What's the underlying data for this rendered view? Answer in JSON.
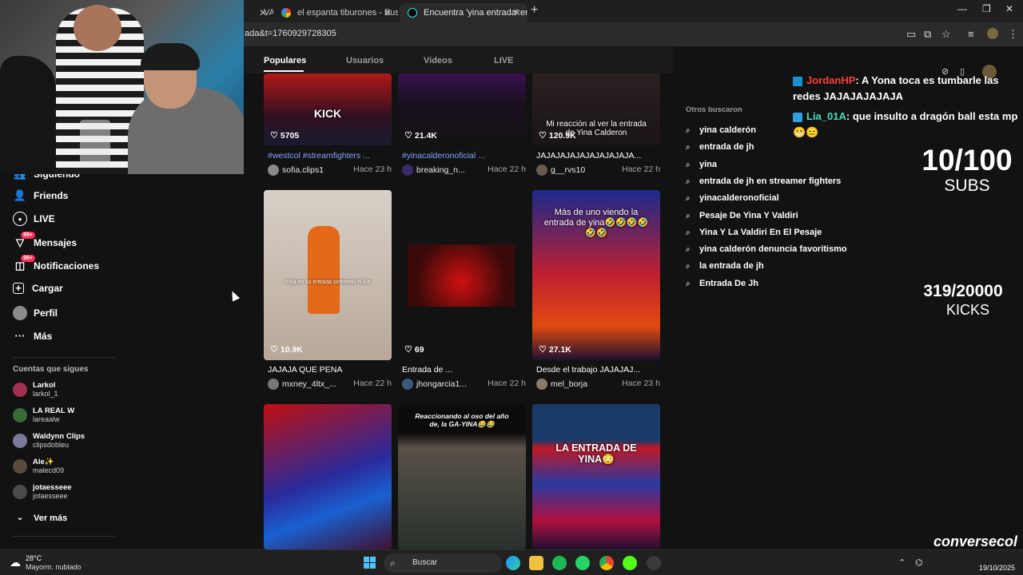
{
  "browser": {
    "tabs": [
      {
        "label": "VA",
        "active": false
      },
      {
        "label": "el espanta tiburones - Buscar c",
        "active": false
      },
      {
        "label": "Encuentra 'yina entrada' en Tik",
        "active": true
      }
    ],
    "url": "ada&t=1760929728305",
    "new_tab": "+",
    "controls": {
      "minimize": "—",
      "restore": "❐",
      "close": "✕"
    }
  },
  "search_tabs": [
    "Populares",
    "Usuarios",
    "Videos",
    "LIVE"
  ],
  "sidebar": {
    "items": [
      {
        "label": "Siguiendo",
        "icon": "following-icon"
      },
      {
        "label": "Friends",
        "icon": "friends-icon"
      },
      {
        "label": "LIVE",
        "icon": "live-icon"
      },
      {
        "label": "Mensajes",
        "icon": "messages-icon",
        "badge": "99+"
      },
      {
        "label": "Notificaciones",
        "icon": "notifications-icon",
        "badge": "99+"
      },
      {
        "label": "Cargar",
        "icon": "upload-icon"
      },
      {
        "label": "Perfil",
        "icon": "profile-icon"
      },
      {
        "label": "Más",
        "icon": "more-icon"
      }
    ],
    "following_title": "Cuentas que sigues",
    "following": [
      {
        "name": "Larkol",
        "handle": "larkol_1"
      },
      {
        "name": "LA REAL W",
        "handle": "lareaalw"
      },
      {
        "name": "Waldynn Clips",
        "handle": "clipsdobleu"
      },
      {
        "name": "Ale✨",
        "handle": "malecd09"
      },
      {
        "name": "jotaesseee",
        "handle": "jotaesseee"
      }
    ],
    "see_more": "Ver más"
  },
  "videos": [
    {
      "likes": "5705",
      "caption": "#westcol #streamfighters ...",
      "user": "sofia.clips1",
      "time": "Hace 23 h",
      "overlay": "KICK",
      "tag": true
    },
    {
      "likes": "21.4K",
      "caption": "#yinacalderonoficial ...",
      "user": "breaking_n...",
      "time": "Hace 22 h",
      "overlay": "",
      "tag": true
    },
    {
      "likes": "120.9K",
      "caption": "JAJAJAJAJAJAJAJAJAJA...",
      "user": "g__rvs10",
      "time": "Hace 22 h",
      "overlay": "Mi reacción al ver la entrada de Yina Calderon",
      "tag": false
    },
    {
      "likes": "10.9K",
      "caption": "JAJAJA QUE PENA",
      "user": "mxney_4ltx_...",
      "time": "Hace 22 h",
      "overlay": "Yina en su entrada sintiendo el kie",
      "tag": false
    },
    {
      "likes": "69",
      "caption": "Entrada de ...",
      "user": "jhongarcia1...",
      "time": "Hace 22 h",
      "overlay": "",
      "tag": false
    },
    {
      "likes": "27.1K",
      "caption": "Desde el trabajo JAJAJAJ...",
      "user": "mel_borja",
      "time": "Hace 23 h",
      "overlay": "Más de uno viendo la entrada de yina🤣🤣🤣🤣🤣🤣",
      "tag": false
    },
    {
      "likes": "",
      "caption": "",
      "user": "",
      "time": "",
      "overlay": "",
      "tag": false
    },
    {
      "likes": "",
      "caption": "",
      "user": "",
      "time": "",
      "overlay": "Reaccionando al oso del año de, la GA-YINA😂😂",
      "tag": false
    },
    {
      "likes": "",
      "caption": "",
      "user": "",
      "time": "",
      "overlay": "LA ENTRADA DE YINA😳",
      "tag": false
    }
  ],
  "others_searched": {
    "title": "Otros buscaron",
    "items": [
      "yina calderón",
      "entrada de jh",
      "yina",
      "entrada de jh en streamer fighters",
      "yinacalderonoficial",
      "Pesaje De Yina Y Valdiri",
      "Yina Y La Valdiri En El Pesaje",
      "yina calderón denuncia favoritismo",
      "la entrada de jh",
      "Entrada De Jh"
    ]
  },
  "chat": [
    {
      "user": "JordanHP",
      "text": ": A Yona toca es tumbarle las redes JAJAJAJAJAJA"
    },
    {
      "user": "Lia_01A",
      "text": ": que insulto a dragón ball esta mp 😬😑"
    }
  ],
  "stats": {
    "subs_value": "10/100",
    "subs_label": "SUBS",
    "kicks_value": "319/20000",
    "kicks_label": "KICKS"
  },
  "taskbar": {
    "temperature": "28°C",
    "weather": "Mayorm. nublado",
    "search_placeholder": "Buscar",
    "date": "19/10/2025"
  },
  "watermark": "conversecol",
  "colors": {
    "accent": "#fe2c55",
    "tag": "#7ea5ff",
    "chat_user_1": "#fe3b3b",
    "chat_user_2": "#40e0c0"
  }
}
